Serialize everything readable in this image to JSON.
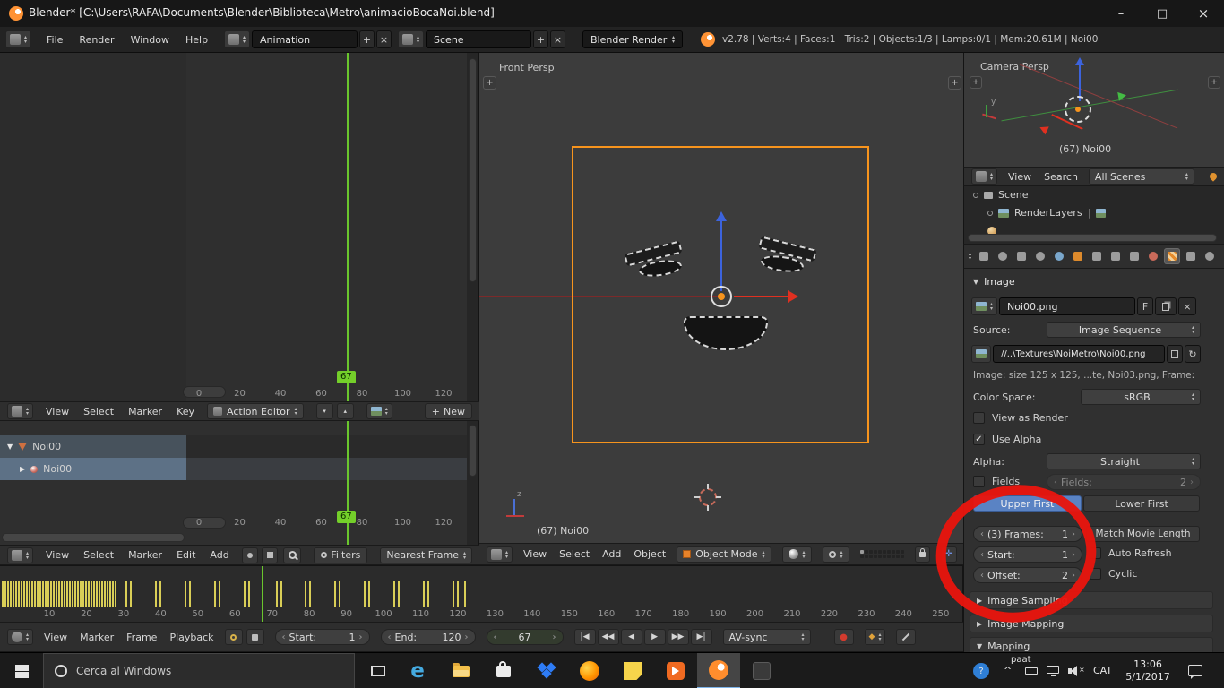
{
  "icons": {
    "minimize": "–",
    "maximize": "□",
    "close": "×",
    "plus": "+",
    "x_small": "×",
    "fake_user": "F",
    "check": "✓",
    "question": "?",
    "caret": "^",
    "tri_down": "▼",
    "tri_right": "▶",
    "chev_left": "‹",
    "chev_right": "›",
    "jump_start": "|◀",
    "prev_key": "◀◀",
    "play_rev": "◀",
    "play": "▶",
    "next_key": "▶▶",
    "jump_end": "▶|",
    "record": "●",
    "key_diamond": "◆",
    "refresh": "↻"
  },
  "window": {
    "title": "Blender* [C:\\Users\\RAFA\\Documents\\Blender\\Biblioteca\\Metro\\animacioBocaNoi.blend]"
  },
  "info_bar": {
    "menus": [
      "File",
      "Render",
      "Window",
      "Help"
    ],
    "layout": "Animation",
    "scene": "Scene",
    "engine": "Blender Render",
    "stats": "v2.78 | Verts:4 | Faces:1 | Tris:2 | Objects:1/3 | Lamps:0/1 | Mem:20.61M | Noi00"
  },
  "dopesheet": {
    "ruler_labels": [
      "0",
      "20",
      "40",
      "60",
      "80",
      "100",
      "120"
    ],
    "current_frame": "67"
  },
  "action_editor": {
    "menus": [
      "View",
      "Select",
      "Marker",
      "Key"
    ],
    "mode": "Action Editor",
    "new_button": "New",
    "channels": [
      {
        "label": "Noi00"
      },
      {
        "label": "Noi00"
      }
    ]
  },
  "dopesheet_footer": {
    "menus": [
      "View",
      "Select",
      "Marker",
      "Edit",
      "Add"
    ],
    "filters": "Filters",
    "nearest_frame": "Nearest Frame"
  },
  "viewport_3d": {
    "view_label": "Front Persp",
    "object_label": "(67) Noi00",
    "menus": [
      "View",
      "Select",
      "Add",
      "Object"
    ],
    "mode": "Object Mode"
  },
  "camera_view": {
    "view_label": "Camera Persp",
    "object_label": "(67) Noi00"
  },
  "outliner": {
    "menus": [
      "View",
      "Search"
    ],
    "filter": "All Scenes",
    "items": [
      {
        "label": "Scene"
      },
      {
        "label": "RenderLayers"
      }
    ]
  },
  "properties": {
    "tabs": [
      {
        "name": "editor-type-selector",
        "shape": "rect"
      },
      {
        "name": "render-tab",
        "shape": "circle"
      },
      {
        "name": "render-layers-tab",
        "shape": "rect"
      },
      {
        "name": "scene-tab",
        "shape": "circle"
      },
      {
        "name": "world-tab",
        "shape": "blue"
      },
      {
        "name": "object-tab",
        "shape": "orange"
      },
      {
        "name": "constraints-tab",
        "shape": "rect"
      },
      {
        "name": "modifiers-tab",
        "shape": "rect"
      },
      {
        "name": "data-tab",
        "shape": "rect"
      },
      {
        "name": "material-tab",
        "shape": "red"
      },
      {
        "name": "texture-tab",
        "shape": "checker",
        "active": true
      },
      {
        "name": "particles-tab",
        "shape": "rect"
      },
      {
        "name": "physics-tab",
        "shape": "circle"
      }
    ],
    "panel_image": "Image",
    "datablock_name": "Noi00.png",
    "source_label": "Source:",
    "source": "Image Sequence",
    "filepath": "//..\\Textures\\NoiMetro\\Noi00.png",
    "image_info": "Image: size 125 x 125, ...te, Noi03.png, Frame:",
    "color_space_label": "Color Space:",
    "color_space": "sRGB",
    "view_as_render": "View as Render",
    "use_alpha": "Use Alpha",
    "alpha_label": "Alpha:",
    "alpha_mode": "Straight",
    "fields_toggle": "Fields",
    "fields_slider_label": "Fields:",
    "fields_value": "2",
    "upper_first": "Upper First",
    "lower_first": "Lower First",
    "frames_label": "(3) Frames:",
    "frames_value": "1",
    "match_movie_length": "Match Movie Length",
    "start_label": "Start:",
    "start_value": "1",
    "auto_refresh": "Auto Refresh",
    "offset_label": "Offset:",
    "offset_value": "2",
    "cyclic": "Cyclic",
    "panel_image_sampling": "Image Sampling",
    "panel_image_mapping": "Image Mapping",
    "panel_mapping": "Mapping"
  },
  "timeline": {
    "menus": [
      "View",
      "Marker",
      "Frame",
      "Playback"
    ],
    "start_label": "Start:",
    "start_value": "1",
    "end_label": "End:",
    "end_value": "120",
    "current_frame": "67",
    "sync": "AV-sync",
    "ruler_labels": [
      "10",
      "20",
      "30",
      "40",
      "50",
      "60",
      "70",
      "80",
      "90",
      "100",
      "110",
      "120",
      "130",
      "140",
      "150",
      "160",
      "170",
      "180",
      "190",
      "200",
      "210",
      "220",
      "230",
      "240",
      "250"
    ],
    "keyframe_ticks_x": [
      2,
      5,
      8,
      11,
      14,
      17,
      20,
      23,
      26,
      29,
      32,
      35,
      38,
      41,
      44,
      47,
      50,
      53,
      56,
      59,
      62,
      65,
      68,
      71,
      74,
      77,
      80,
      83,
      86,
      89,
      92,
      95,
      98,
      101,
      104,
      107,
      110,
      113,
      116,
      119,
      122,
      125,
      128,
      140,
      145,
      173,
      178,
      206,
      211,
      239,
      244,
      272,
      277,
      308,
      313,
      340,
      345,
      373,
      378,
      406,
      411,
      439,
      444,
      472,
      477,
      505,
      510,
      518
    ]
  },
  "taskbar": {
    "search_placeholder": "Cerca al Windows",
    "stray_text": "paat",
    "language": "CAT",
    "time": "13:06",
    "date": "5/1/2017"
  },
  "colors": {
    "accent_orange": "#f7941d",
    "frame_green": "#6ecf2d",
    "keyframe_yellow": "#d9ce57",
    "annotation_red": "#e8150e",
    "selected_blue": "#5a83c4"
  }
}
